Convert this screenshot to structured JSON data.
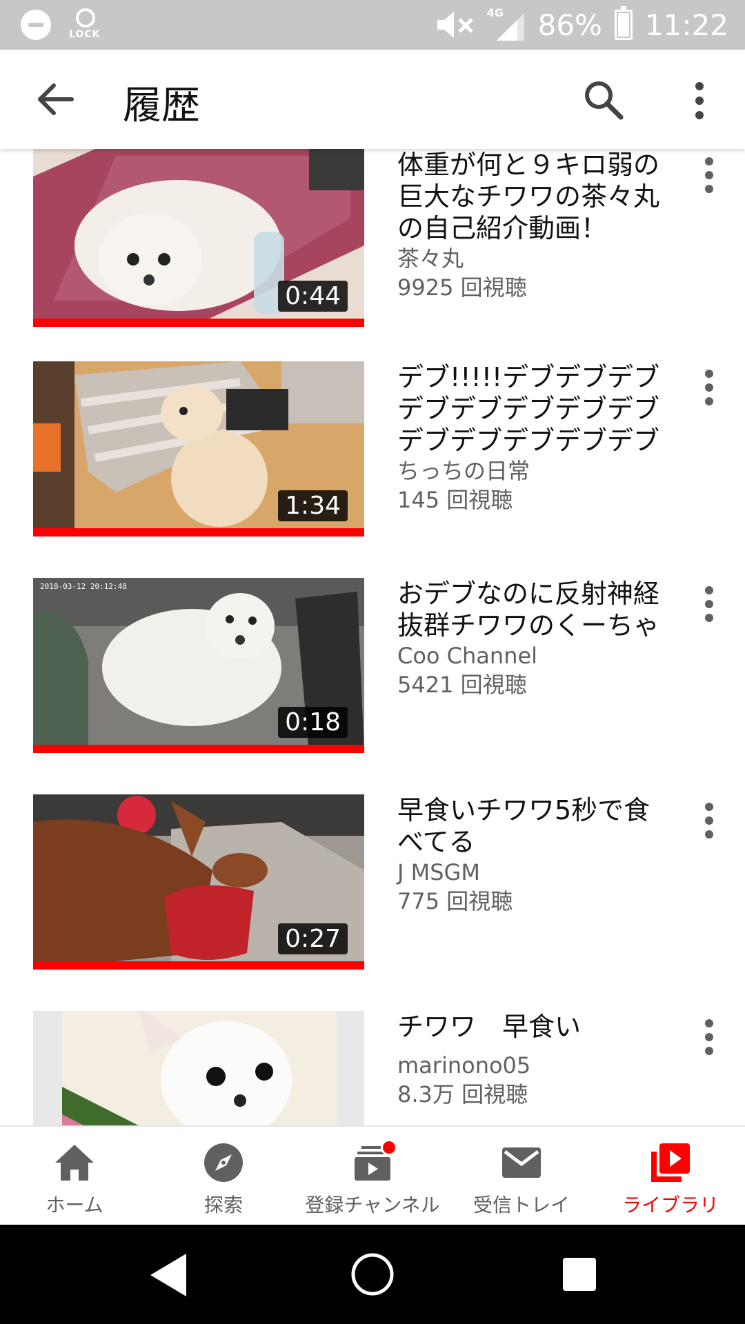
{
  "status_bar": {
    "lock_label": "LOCK",
    "network": "4G",
    "battery": "86%",
    "time": "11:22"
  },
  "app_bar": {
    "title": "履歴"
  },
  "videos": [
    {
      "title": "体重が何と９キロ弱の巨大なチワワの茶々丸の自己紹介動画！",
      "channel": "茶々丸",
      "views": "9925 回視聴",
      "duration": "0:44",
      "progress": 1.0
    },
    {
      "title": "デブ!!!!!デブデブデブデブデブデブデブデブデブデブデブデブデブデブデブデブデブ…",
      "channel": "ちっちの日常",
      "views": "145 回視聴",
      "duration": "1:34",
      "progress": 1.0
    },
    {
      "title": "おデブなのに反射神経抜群チワワのくーちゃん！",
      "channel": "Coo Channel",
      "views": "5421 回視聴",
      "duration": "0:18",
      "progress": 1.0
    },
    {
      "title": "早食いチワワ5秒で食べてる",
      "channel": "J MSGM",
      "views": "775 回視聴",
      "duration": "0:27",
      "progress": 1.0
    },
    {
      "title": "チワワ　早食い",
      "channel": "marinono05",
      "views": "8.3万 回視聴",
      "duration": "",
      "progress": null
    }
  ],
  "bottom_nav": [
    {
      "label": "ホーム",
      "icon": "home-icon"
    },
    {
      "label": "探索",
      "icon": "explore-icon"
    },
    {
      "label": "登録チャンネル",
      "icon": "subscriptions-icon"
    },
    {
      "label": "受信トレイ",
      "icon": "inbox-icon"
    },
    {
      "label": "ライブラリ",
      "icon": "library-icon"
    }
  ],
  "colors": {
    "accent": "#ff0000",
    "status_bar": "#c7c7c7",
    "secondary_text": "#606060"
  }
}
